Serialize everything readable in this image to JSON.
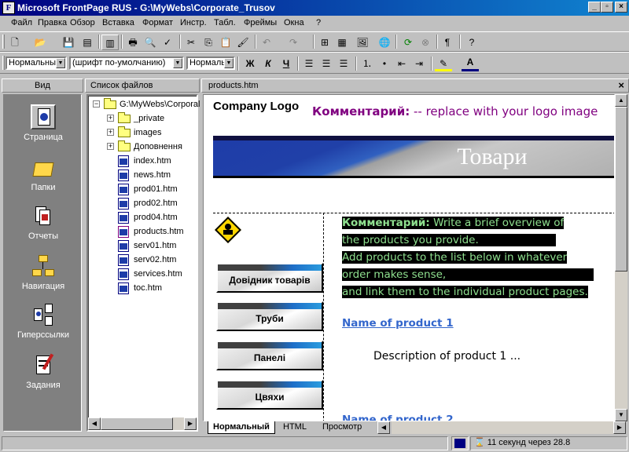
{
  "window": {
    "title": "Microsoft FrontPage RUS - G:\\MyWebs\\Corporate_Trusov"
  },
  "menu": [
    "Файл",
    "Правка",
    "Обзор",
    "Вставка",
    "Формат",
    "Инстр.",
    "Табл.",
    "Фреймы",
    "Окна",
    "?"
  ],
  "format_toolbar": {
    "style": "Нормальный",
    "font": "(шрифт по-умолчанию)",
    "size": "Нормаль",
    "bold": "Ж",
    "italic": "К",
    "underline": "Ч",
    "font_color_letter": "A"
  },
  "views_bar": {
    "title": "Вид",
    "items": [
      {
        "label": "Страница",
        "icon": "page-view-icon"
      },
      {
        "label": "Папки",
        "icon": "folders-view-icon"
      },
      {
        "label": "Отчеты",
        "icon": "reports-view-icon"
      },
      {
        "label": "Навигация",
        "icon": "navigation-view-icon"
      },
      {
        "label": "Гиперссылки",
        "icon": "hyperlinks-view-icon"
      },
      {
        "label": "Задания",
        "icon": "tasks-view-icon"
      }
    ]
  },
  "file_list": {
    "title": "Список файлов",
    "root": "G:\\MyWebs\\Corporal",
    "folders": [
      "_private",
      "images",
      "Доповнення"
    ],
    "files": [
      "index.htm",
      "news.htm",
      "prod01.htm",
      "prod02.htm",
      "prod04.htm",
      "products.htm",
      "serv01.htm",
      "serv02.htm",
      "services.htm",
      "toc.htm"
    ]
  },
  "editor": {
    "tab_title": "products.htm",
    "tabs": [
      "Нормальный",
      "HTML",
      "Просмотр"
    ]
  },
  "page": {
    "logo": "Company Logo",
    "logo_comment_label": "Комментарий:",
    "logo_comment_text": " -- replace with your logo image",
    "banner_title": "Товари",
    "nav_buttons": [
      "Довідник товарів",
      "Труби",
      "Панелі",
      "Цвяхи"
    ],
    "comment_label": "Комментарий:",
    "comment_lines": [
      " Write a brief overview of",
      "the products you provide.",
      "Add products to the list below in whatever",
      "order makes sense,",
      "and link them to the individual product pages."
    ],
    "product1_name": "Name of product 1",
    "product1_desc": "Description of product 1 ...",
    "product2_name": "Name of product 2"
  },
  "status": {
    "text": "11 секунд через 28.8"
  },
  "colors": {
    "titlebar_start": "#000080",
    "comment_purple": "#800080",
    "comment_green": "#8fe08f",
    "link_blue": "#3366cc",
    "banner_blue": "#1e3ca8"
  }
}
